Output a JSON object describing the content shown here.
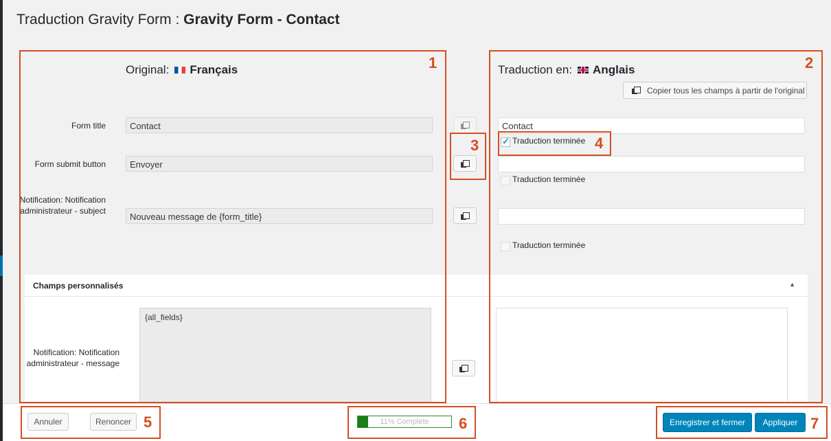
{
  "title": {
    "prefix": "Traduction Gravity Form : ",
    "form_name": "Gravity Form - Contact"
  },
  "original": {
    "label": "Original:",
    "language": "Français",
    "flag": "fr-flag-icon"
  },
  "translation": {
    "label": "Traduction en:",
    "language": "Anglais",
    "flag": "uk-flag-icon"
  },
  "copy_all_label": "Copier tous les champs à partir de l'original",
  "fields": [
    {
      "label": "Form title",
      "original": "Contact",
      "translation": "Contact",
      "done_label": "Traduction terminée",
      "done": true
    },
    {
      "label": "Form submit button",
      "original": "Envoyer",
      "translation": "",
      "done_label": "Traduction terminée",
      "done": false
    },
    {
      "label": "Notification: Notification administrateur - subject",
      "original": "Nouveau message de {form_title}",
      "translation": "",
      "done_label": "Traduction terminée",
      "done": false
    }
  ],
  "custom_section": {
    "title": "Champs personnalisés",
    "field": {
      "label": "Notification: Notification administrateur - message",
      "original": "{all_fields}",
      "translation": ""
    }
  },
  "annotations": [
    "1",
    "2",
    "3",
    "4",
    "5",
    "6",
    "7"
  ],
  "footer": {
    "cancel_label": "Annuler",
    "abandon_label": "Renoncer",
    "progress_text": "11% Complete",
    "progress_percent": 11,
    "save_close_label": "Enregistrer et fermer",
    "apply_label": "Appliquer"
  },
  "colors": {
    "annotation": "#d54e21",
    "primary": "#0085ba",
    "progress": "#1a7f1a"
  }
}
